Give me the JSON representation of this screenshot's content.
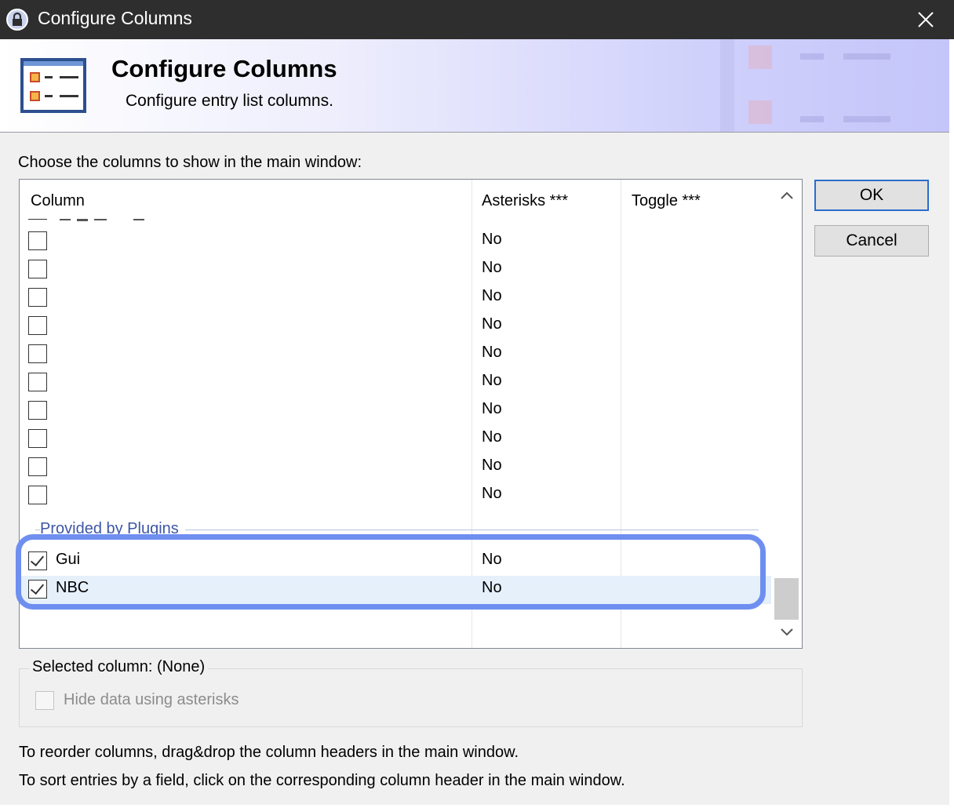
{
  "window": {
    "title": "Configure Columns"
  },
  "banner": {
    "heading": "Configure Columns",
    "subtitle": "Configure entry list columns."
  },
  "instruction": "Choose the columns to show in the main window:",
  "list": {
    "headers": [
      "Column",
      "Asterisks ***",
      "Toggle ***"
    ],
    "standard_rows": [
      {
        "checked": false,
        "name": "",
        "asterisks": "No"
      },
      {
        "checked": false,
        "name": "",
        "asterisks": "No"
      },
      {
        "checked": false,
        "name": "",
        "asterisks": "No"
      },
      {
        "checked": false,
        "name": "",
        "asterisks": "No"
      },
      {
        "checked": false,
        "name": "",
        "asterisks": "No"
      },
      {
        "checked": false,
        "name": "",
        "asterisks": "No"
      },
      {
        "checked": false,
        "name": "",
        "asterisks": "No"
      },
      {
        "checked": false,
        "name": "",
        "asterisks": "No"
      },
      {
        "checked": false,
        "name": "",
        "asterisks": "No"
      },
      {
        "checked": false,
        "name": "",
        "asterisks": "No"
      }
    ],
    "group_label": "Provided by Plugins",
    "plugin_rows": [
      {
        "checked": true,
        "name": "Gui",
        "asterisks": "No"
      },
      {
        "checked": true,
        "name": "NBC",
        "asterisks": "No"
      }
    ]
  },
  "buttons": {
    "ok": "OK",
    "cancel": "Cancel"
  },
  "selected_column": {
    "legend": "Selected column: (None)",
    "hide_label": "Hide data using asterisks"
  },
  "notes": [
    "To reorder columns, drag&drop the column headers in the main window.",
    "To sort entries by a field, click on the corresponding column header in the main window."
  ],
  "colors": {
    "highlight": "#6e8ff0",
    "selected_row": "#e5f0fb",
    "group_text": "#3d56a6"
  }
}
